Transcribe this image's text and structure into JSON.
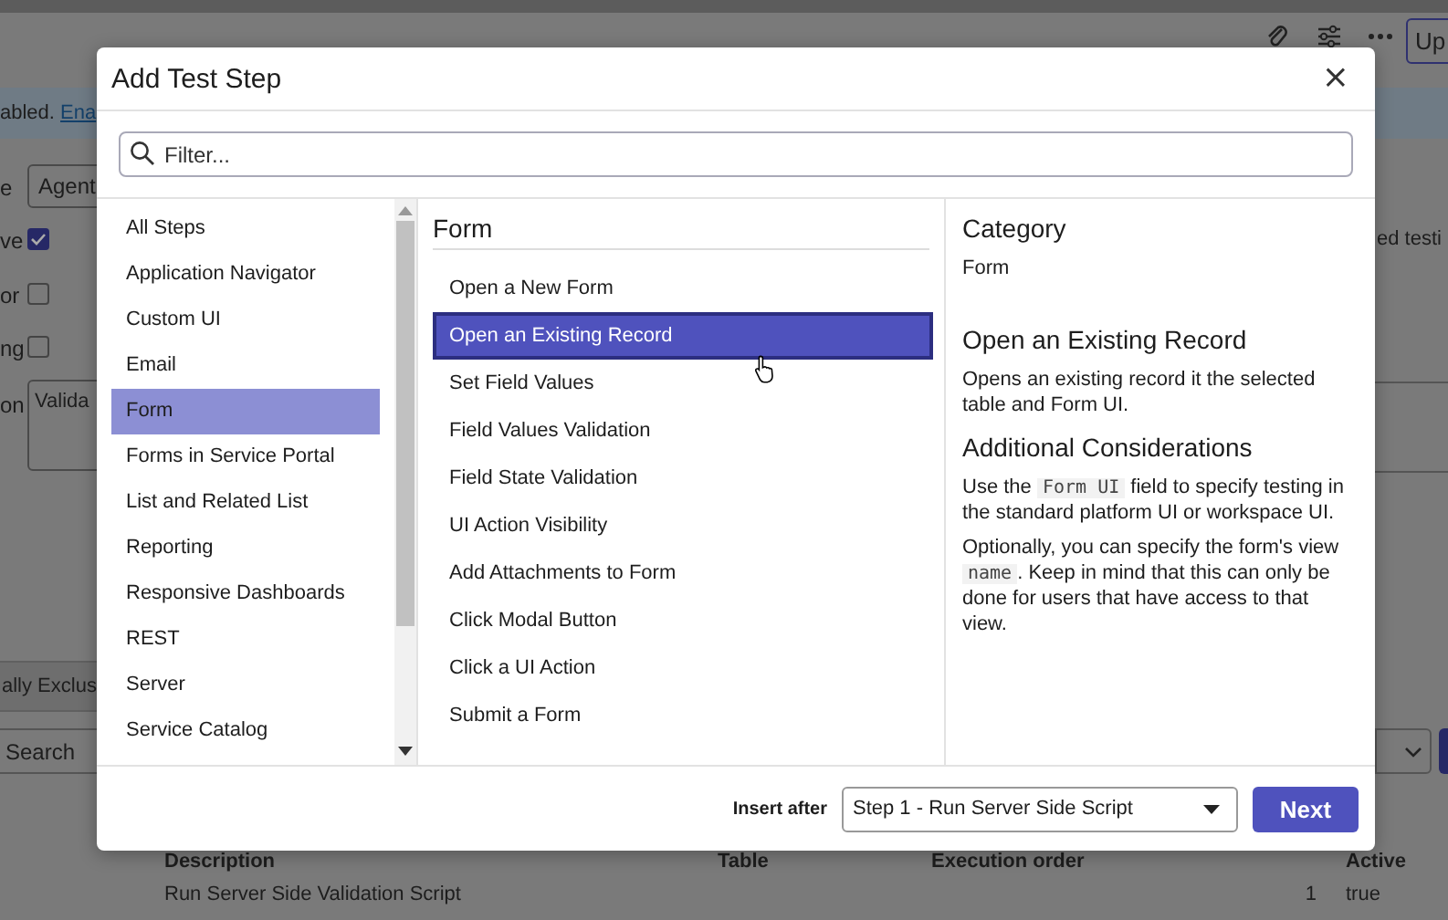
{
  "background": {
    "top_button": "Up",
    "banner": {
      "text": "abled. ",
      "link": "Ena"
    },
    "fields": [
      {
        "label": "e",
        "kind": "input",
        "value": "Agent"
      },
      {
        "label": "ve",
        "kind": "checkbox",
        "checked": true
      },
      {
        "label": "or",
        "kind": "checkbox",
        "checked": false
      },
      {
        "label": "ng",
        "kind": "checkbox",
        "checked": false
      },
      {
        "label": "on",
        "kind": "textarea",
        "value": "Valida"
      }
    ],
    "side_text": "ed testi",
    "tab_button": "ally Exclus",
    "search_placeholder": "Search",
    "table": {
      "columns": [
        "Description",
        "Table",
        "Execution order",
        "Active"
      ],
      "rows": [
        [
          "Run Server Side Validation Script",
          "",
          "1",
          "true"
        ]
      ]
    }
  },
  "dialog": {
    "title": "Add Test Step",
    "close": "×",
    "filter_placeholder": "Filter...",
    "categories": [
      {
        "label": "All Steps",
        "selected": false
      },
      {
        "label": "Application Navigator",
        "selected": false
      },
      {
        "label": "Custom UI",
        "selected": false
      },
      {
        "label": "Email",
        "selected": false
      },
      {
        "label": "Form",
        "selected": true
      },
      {
        "label": "Forms in Service Portal",
        "selected": false
      },
      {
        "label": "List and Related List",
        "selected": false
      },
      {
        "label": "Reporting",
        "selected": false
      },
      {
        "label": "Responsive Dashboards",
        "selected": false
      },
      {
        "label": "REST",
        "selected": false
      },
      {
        "label": "Server",
        "selected": false
      },
      {
        "label": "Service Catalog",
        "selected": false
      }
    ],
    "list_title": "Form",
    "steps": [
      {
        "label": "Open a New Form",
        "selected": false
      },
      {
        "label": "Open an Existing Record",
        "selected": true
      },
      {
        "label": "Set Field Values",
        "selected": false
      },
      {
        "label": "Field Values Validation",
        "selected": false
      },
      {
        "label": "Field State Validation",
        "selected": false
      },
      {
        "label": "UI Action Visibility",
        "selected": false
      },
      {
        "label": "Add Attachments to Form",
        "selected": false
      },
      {
        "label": "Click Modal Button",
        "selected": false
      },
      {
        "label": "Click a UI Action",
        "selected": false
      },
      {
        "label": "Submit a Form",
        "selected": false
      }
    ],
    "details": {
      "category_heading": "Category",
      "category": "Form",
      "step_title": "Open an Existing Record",
      "step_description": "Opens an existing record it the selected table and Form UI.",
      "considerations_heading": "Additional Considerations",
      "paragraphs": [
        [
          {
            "kind": "text",
            "text": "Use the "
          },
          {
            "kind": "code",
            "text": "Form UI"
          },
          {
            "kind": "text",
            "text": " field to specify testing in the standard platform UI or workspace UI."
          }
        ],
        [
          {
            "kind": "text",
            "text": "Optionally, you can specify the form's view "
          },
          {
            "kind": "code",
            "text": "name"
          },
          {
            "kind": "text",
            "text": ". Keep in mind that this can only be done for users that have access to that view."
          }
        ]
      ]
    },
    "insert_after_label": "Insert after",
    "insert_after_value": "Step 1 - Run Server Side Script",
    "next_button": "Next"
  }
}
